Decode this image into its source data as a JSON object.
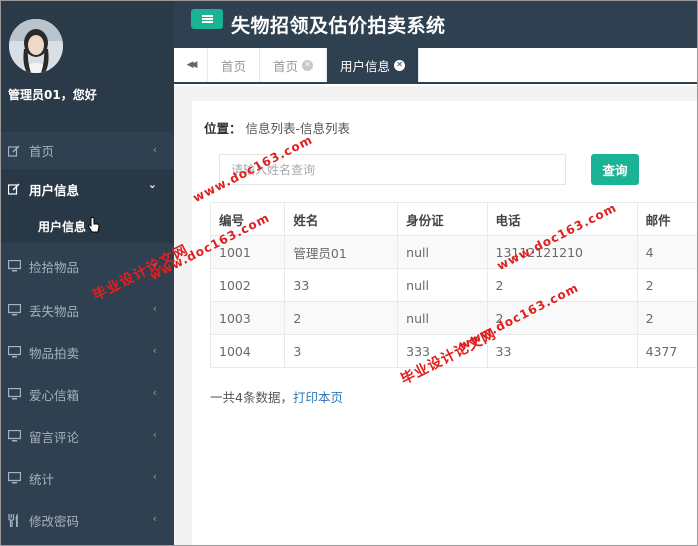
{
  "app": {
    "title": "失物招领及估价拍卖系统"
  },
  "sidebar": {
    "welcome": "管理员01，您好",
    "items": [
      {
        "label": "首页",
        "icon": "edit-icon",
        "arrow": "‹"
      },
      {
        "label": "用户信息",
        "icon": "edit-icon",
        "arrow": "⌄",
        "expanded": true,
        "sub": "用户信息"
      },
      {
        "label": "捡拾物品",
        "icon": "monitor-icon",
        "arrow": "‹"
      },
      {
        "label": "丢失物品",
        "icon": "monitor-icon",
        "arrow": "‹"
      },
      {
        "label": "物品拍卖",
        "icon": "monitor-icon",
        "arrow": "‹"
      },
      {
        "label": "爱心信箱",
        "icon": "monitor-icon",
        "arrow": "‹"
      },
      {
        "label": "留言评论",
        "icon": "monitor-icon",
        "arrow": "‹"
      },
      {
        "label": "统计",
        "icon": "monitor-icon",
        "arrow": "‹"
      },
      {
        "label": "修改密码",
        "icon": "cutlery-icon",
        "arrow": "‹"
      }
    ]
  },
  "tabs": {
    "back": "◀◀",
    "items": [
      {
        "label": "首页",
        "closable": false
      },
      {
        "label": "首页",
        "closable": true
      },
      {
        "label": "用户信息",
        "closable": true,
        "active": true
      }
    ]
  },
  "main": {
    "location_label": "位置：",
    "location_path": "信息列表-信息列表",
    "search_placeholder": "请输入姓名查询",
    "search_button": "查询",
    "table": {
      "headers": [
        "编号",
        "姓名",
        "身份证",
        "电话",
        "邮件"
      ],
      "rows": [
        [
          "1001",
          "管理员01",
          "null",
          "13112121210",
          "4"
        ],
        [
          "1002",
          "33",
          "null",
          "2",
          "2"
        ],
        [
          "1003",
          "2",
          "null",
          "2",
          "2"
        ],
        [
          "1004",
          "3",
          "333",
          "33",
          "4377"
        ]
      ]
    },
    "footer_count": "一共4条数据，",
    "print_link": "打印本页"
  },
  "watermarks": [
    "毕业设计论文网",
    "www.doc163.com"
  ],
  "colors": {
    "sidebar": "#2f4050",
    "accent": "#1ab394",
    "watermark": "#e02020"
  }
}
